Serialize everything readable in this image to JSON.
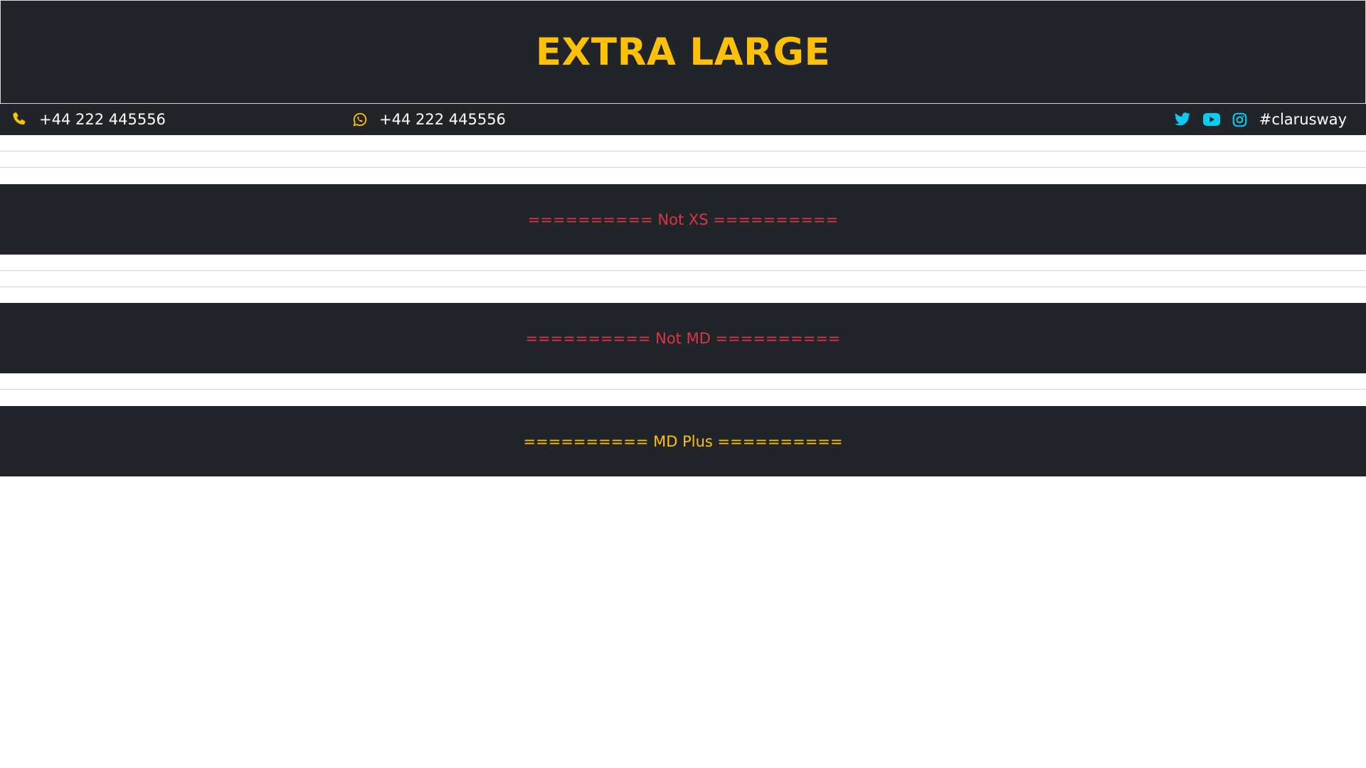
{
  "header": {
    "title": "EXTRA LARGE"
  },
  "contact": {
    "phone": "+44 222 445556",
    "whatsapp": "+44 222 445556",
    "hashtag": "#clarusway",
    "icons": [
      "phone-icon",
      "whatsapp-icon",
      "twitter-icon",
      "youtube-icon",
      "instagram-icon"
    ]
  },
  "bands": {
    "not_xs": "========== Not XS ==========",
    "not_md": "========== Not MD ==========",
    "md_plus": "========== MD Plus =========="
  },
  "colors": {
    "dark_bg": "#212529",
    "warning": "#ffc107",
    "danger": "#dc3545",
    "info": "#0dcaf0"
  }
}
